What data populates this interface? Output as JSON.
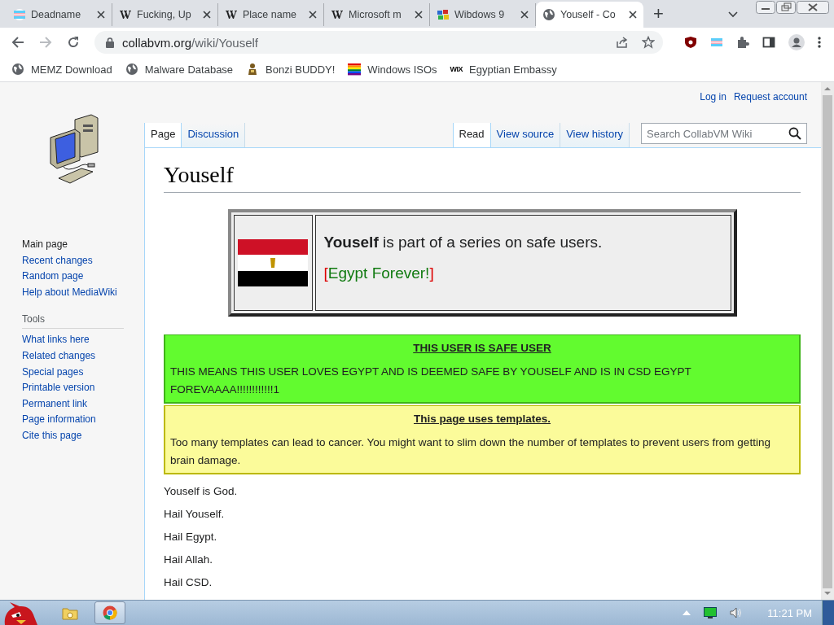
{
  "browser": {
    "tabs": [
      {
        "title": "Deadname",
        "kind": "flag",
        "selected": false
      },
      {
        "title": "Fucking, Up",
        "kind": "wiki",
        "selected": false
      },
      {
        "title": "Place name",
        "kind": "wiki",
        "selected": false
      },
      {
        "title": "Microsoft m",
        "kind": "wiki",
        "selected": false
      },
      {
        "title": "Wibdows 9",
        "kind": "app",
        "selected": false
      },
      {
        "title": "Youself - Co",
        "kind": "globe",
        "selected": true
      }
    ],
    "new_tab": "+",
    "url_host": "collabvm.org",
    "url_path": "/wiki/Youself",
    "bookmarks": [
      {
        "kind": "globe",
        "label": "MEMZ Download"
      },
      {
        "kind": "globe",
        "label": "Malware Database"
      },
      {
        "kind": "figure",
        "label": "Bonzi BUDDY!"
      },
      {
        "kind": "rainbow",
        "label": "Windows ISOs"
      },
      {
        "kind": "wordmark",
        "mark": "WIX",
        "label": "Egyptian Embassy"
      }
    ]
  },
  "wiki": {
    "personal_links": [
      "Log in",
      "Request account"
    ],
    "left_tabs": [
      {
        "label": "Page",
        "selected": true
      },
      {
        "label": "Discussion",
        "selected": false
      }
    ],
    "right_tabs": [
      {
        "label": "Read",
        "selected": true
      },
      {
        "label": "View source",
        "selected": false
      },
      {
        "label": "View history",
        "selected": false
      }
    ],
    "search": {
      "placeholder": "Search CollabVM Wiki"
    },
    "navigation": [
      "Main page",
      "Recent changes",
      "Random page",
      "Help about MediaWiki"
    ],
    "tools": {
      "heading": "Tools",
      "items": [
        "What links here",
        "Related changes",
        "Special pages",
        "Printable version",
        "Permanent link",
        "Page information",
        "Cite this page"
      ]
    },
    "title": "Youself",
    "series_box": {
      "text": "**Youself** is part of a series on safe users.",
      "slogan_open": "[",
      "slogan": "Egypt Forever!",
      "slogan_close": "]"
    },
    "notices": [
      {
        "kind": "safe",
        "title": "THIS USER IS SAFE USER",
        "body": "THIS MEANS THIS USER LOVES EGYPT AND IS DEEMED SAFE BY YOUSELF AND IS IN CSD EGYPT FOREVAAAA!!!!!!!!!!!!1"
      },
      {
        "kind": "warning",
        "title": "This page uses templates.",
        "body": "Too many templates can lead to cancer. You might want to slim down the number of templates to prevent users from getting brain damage."
      }
    ],
    "paragraphs": [
      "Youself is God.",
      "Hail Youself.",
      "Hail Egypt.",
      "Hail Allah.",
      "Hail CSD."
    ]
  },
  "taskbar": {
    "clock": "11:21 PM"
  }
}
